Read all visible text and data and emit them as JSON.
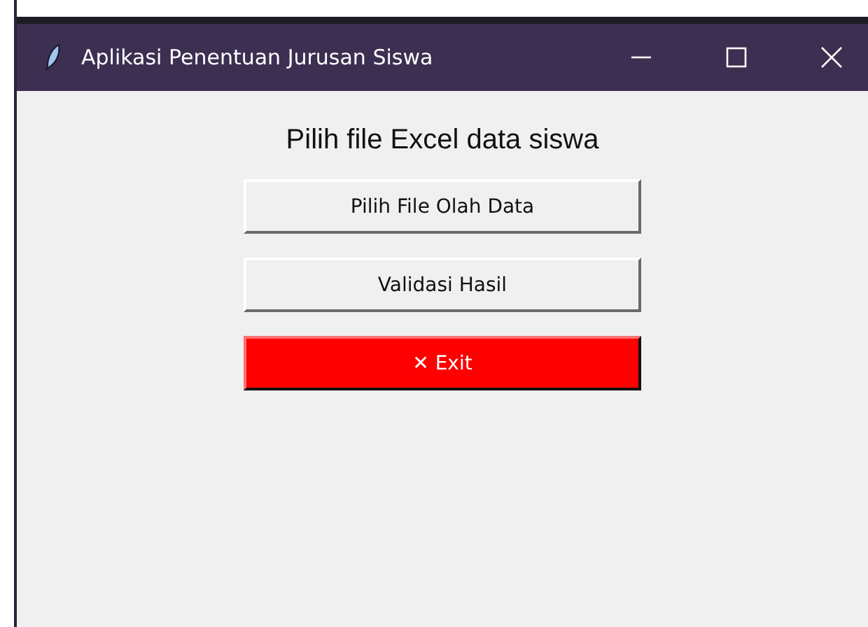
{
  "window": {
    "title": "Aplikasi Penentuan Jurusan Siswa"
  },
  "heading": "Pilih file Excel data siswa",
  "buttons": [
    {
      "label": "Pilih File Olah Data",
      "kind": "normal"
    },
    {
      "label": "Validasi Hasil",
      "kind": "normal"
    },
    {
      "label": "✕ Exit",
      "kind": "danger"
    }
  ]
}
